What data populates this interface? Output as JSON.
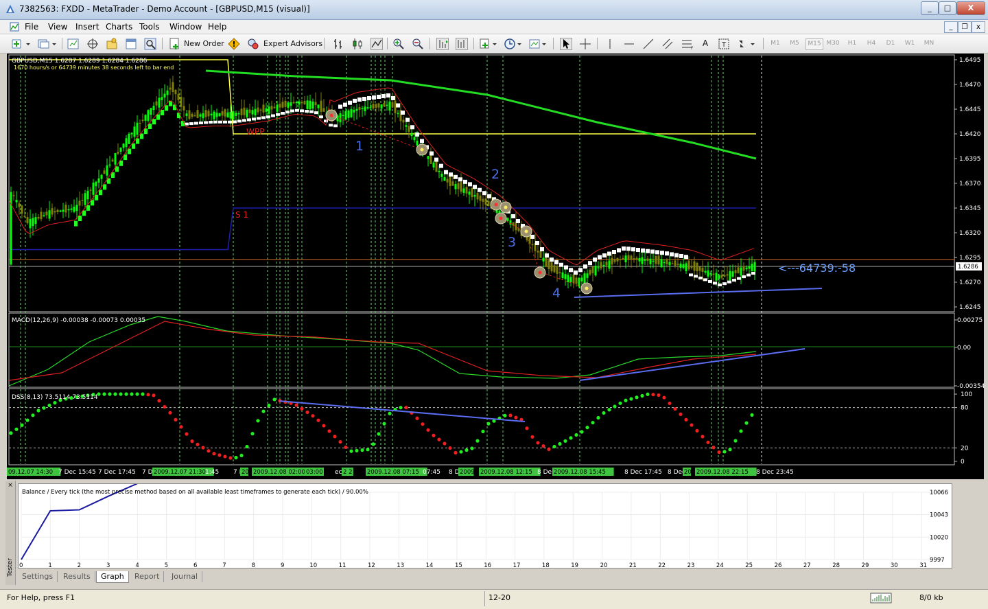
{
  "window": {
    "title": "7382563: FXDD - MetaTrader - Demo Account - [GBPUSD,M15 (visual)]",
    "min_label": "_",
    "max_label": "□",
    "close_label": "X"
  },
  "menu": [
    "File",
    "View",
    "Insert",
    "Charts",
    "Tools",
    "Window",
    "Help"
  ],
  "toolbar": {
    "new_order": "New Order",
    "expert_advisors": "Expert Advisors",
    "text_tool": "A",
    "timeframes": [
      "M1",
      "M5",
      "M15",
      "M30",
      "H1",
      "H4",
      "D1",
      "W1",
      "MN"
    ],
    "selected_timeframe": "M15"
  },
  "chart": {
    "header": "GBPUSD,M15  1.6287 1.6289 1.6284 1.6286",
    "subheader": "1670 hours/s or  64739 minutes  38 seconds left to bar end",
    "wpp_label": "WPP",
    "s1_label": "S 1",
    "wave_labels": [
      "1",
      "2",
      "3",
      "4"
    ],
    "countdown": "<---64739:-58",
    "price_ticks": [
      "1.6495",
      "1.6470",
      "1.6445",
      "1.6420",
      "1.6395",
      "1.6370",
      "1.6345",
      "1.6320",
      "1.6295",
      "1.6286",
      "1.6270",
      "1.6245"
    ],
    "current_price": "1.6286",
    "macd_label": "MACD(12,26,9) -0.00038 -0.00073 0.00035",
    "macd_ticks": [
      "0.00275",
      "0.00",
      "-0.00354"
    ],
    "dss_label": "DSS(8,13) 73.5114 73.5114",
    "dss_ticks": [
      "100",
      "80",
      "20",
      "0"
    ],
    "time_labels": [
      {
        "text": "09.12.07 14:30",
        "hl": true
      },
      {
        "text": "7 Dec 15:45",
        "hl": false
      },
      {
        "text": "7 Dec 17:45",
        "hl": false
      },
      {
        "text": "7 D",
        "hl": false
      },
      {
        "text": "2009.12.07 21:30",
        "hl": true
      },
      {
        "text": "1:45",
        "hl": false
      },
      {
        "text": "7 D",
        "hl": false
      },
      {
        "text": "20",
        "hl": true
      },
      {
        "text": "2009.12.08 02:00",
        "hl": true
      },
      {
        "text": "03:00",
        "hl": true
      },
      {
        "text": "ec 03:",
        "hl": false
      },
      {
        "text": "2 2",
        "hl": true
      },
      {
        "text": "2009.12.08 07:15",
        "hl": true
      },
      {
        "text": "07:45",
        "hl": false
      },
      {
        "text": "8 D",
        "hl": false
      },
      {
        "text": "2009",
        "hl": true
      },
      {
        "text": "2009.12.08 12:15",
        "hl": true
      },
      {
        "text": "8 De",
        "hl": false
      },
      {
        "text": "2009.12.08 15:45",
        "hl": true
      },
      {
        "text": "8 Dec 17:45",
        "hl": false
      },
      {
        "text": "8 Dec",
        "hl": false
      },
      {
        "text": "20",
        "hl": true
      },
      {
        "text": "2009.12.08 22:15",
        "hl": true
      },
      {
        "text": "8 Dec 23:45",
        "hl": false
      }
    ]
  },
  "tester": {
    "graph_title": "Balance / Every tick (the most precise method based on all available least timeframes to generate each tick) / 90.00%",
    "y_ticks": [
      "10066",
      "10043",
      "10020",
      "9997"
    ],
    "x_ticks": [
      "0",
      "1",
      "2",
      "3",
      "4",
      "5",
      "6",
      "7",
      "8",
      "9",
      "10",
      "11",
      "12",
      "13",
      "14",
      "15",
      "16",
      "17",
      "18",
      "19",
      "20",
      "21",
      "22",
      "23",
      "24",
      "25",
      "26",
      "27",
      "28",
      "29",
      "30",
      "31"
    ],
    "side_label": "Tester",
    "tabs": [
      "Settings",
      "Results",
      "Graph",
      "Report",
      "Journal"
    ],
    "active_tab": "Graph"
  },
  "chart_data": {
    "type": "line",
    "title": "Balance / Every tick (the most precise method based on all available least timeframes to generate each tick) / 90.00%",
    "xlabel": "",
    "ylabel": "",
    "x": [
      0,
      1,
      2,
      3,
      4
    ],
    "series": [
      {
        "values": [
          9997,
          10047,
          10048,
          10062,
          10075
        ]
      }
    ],
    "ylim": [
      9997,
      10066
    ],
    "xlim": [
      0,
      31
    ]
  },
  "status": {
    "help": "For Help, press F1",
    "profile": "12-20",
    "traffic": "8/0 kb"
  },
  "colors": {
    "chart_bg": "#000000",
    "ma_green": "#22dd22",
    "pivot_yellow": "#ffff44",
    "support_blue": "#1e1eaa",
    "trend_blue": "#5a6cf0",
    "bull_candle": "#00ff00",
    "bear_candle": "#808000",
    "grid_vline": "#6bd16b"
  }
}
